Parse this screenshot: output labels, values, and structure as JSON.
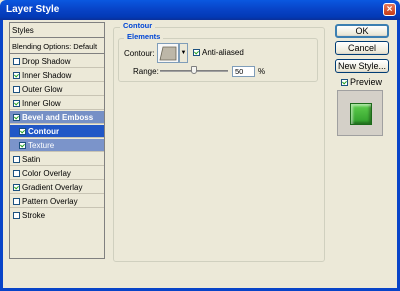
{
  "window": {
    "title": "Layer Style",
    "close_glyph": "×"
  },
  "styles_panel": {
    "header": "Styles",
    "blending": "Blending Options: Default",
    "items": [
      {
        "label": "Drop Shadow",
        "checked": false
      },
      {
        "label": "Inner Shadow",
        "checked": true
      },
      {
        "label": "Outer Glow",
        "checked": false
      },
      {
        "label": "Inner Glow",
        "checked": true
      },
      {
        "label": "Bevel and Emboss",
        "checked": true
      },
      {
        "label": "Contour",
        "checked": true
      },
      {
        "label": "Texture",
        "checked": true
      },
      {
        "label": "Satin",
        "checked": false
      },
      {
        "label": "Color Overlay",
        "checked": false
      },
      {
        "label": "Gradient Overlay",
        "checked": true
      },
      {
        "label": "Pattern Overlay",
        "checked": false
      },
      {
        "label": "Stroke",
        "checked": false
      }
    ]
  },
  "contour_section": {
    "title": "Contour",
    "elements_title": "Elements",
    "contour_label": "Contour:",
    "anti_aliased_label": "Anti-aliased",
    "anti_aliased_checked": true,
    "range_label": "Range:",
    "range_value": "50",
    "range_unit": "%",
    "range_percent": 50
  },
  "buttons": {
    "ok": "OK",
    "cancel": "Cancel",
    "new_style": "New Style...",
    "preview_label": "Preview",
    "preview_checked": true
  },
  "colors": {
    "accent": "#0046d5",
    "selected_row": "#2157c6",
    "preview_green": "#3fb23a"
  }
}
